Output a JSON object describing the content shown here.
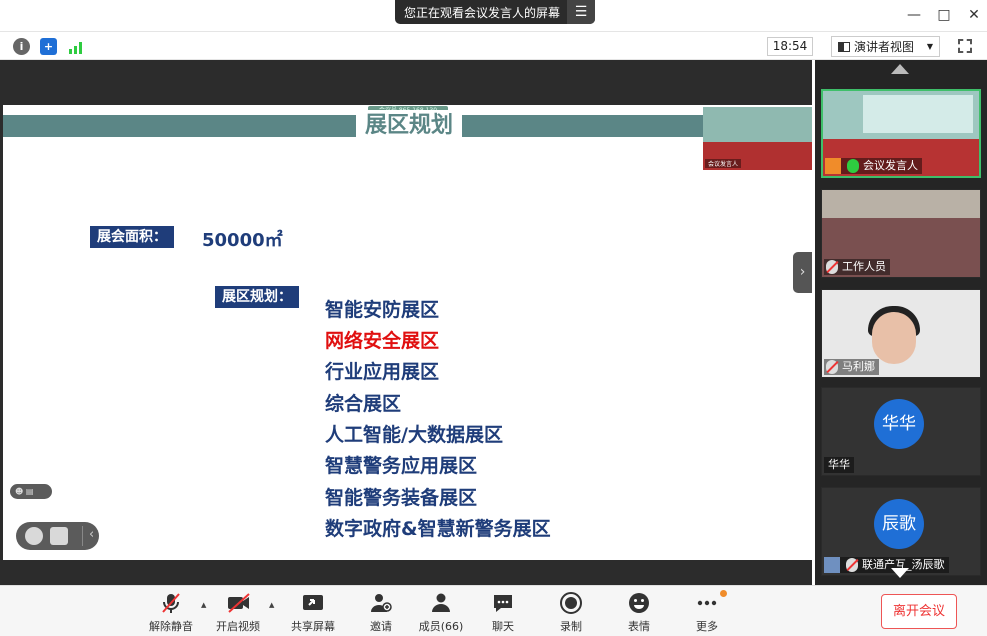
{
  "banner": {
    "text": "您正在观看会议发言人的屏幕",
    "menu_icon": "menu-icon"
  },
  "window": {
    "minimize": "—",
    "maximize": "□",
    "close": "✕"
  },
  "toolbar": {
    "info_icon": "i",
    "security_icon": "+",
    "clock": "18:54",
    "view_mode": "演讲者视图",
    "view_caret": "▼"
  },
  "slide": {
    "meeting_id": "会议号 865 168 130",
    "title": "展区规划",
    "area_label": "展会面积：",
    "area_value": "50000㎡",
    "zones_label": "展区规划：",
    "zones": [
      {
        "text": "智能安防展区",
        "highlight": false
      },
      {
        "text": "网络安全展区",
        "highlight": true
      },
      {
        "text": "行业应用展区",
        "highlight": false
      },
      {
        "text": "综合展区",
        "highlight": false
      },
      {
        "text": "人工智能/大数据展区",
        "highlight": false
      },
      {
        "text": "智慧警务应用展区",
        "highlight": false
      },
      {
        "text": "智能警务装备展区",
        "highlight": false
      },
      {
        "text": "数字政府&智慧新警务展区",
        "highlight": false
      }
    ],
    "pip_name": "会议发言人",
    "reaction_text": "☻ ▤",
    "chat_arrow": "‹"
  },
  "side_arrow": "›",
  "gallery": [
    {
      "name": "会议发言人",
      "mic": "on",
      "active": true,
      "avatar": ""
    },
    {
      "name": "工作人员",
      "mic": "off",
      "active": false,
      "avatar": ""
    },
    {
      "name": "马利娜",
      "mic": "off",
      "active": false,
      "avatar": ""
    },
    {
      "name": "华华",
      "mic": "none",
      "active": false,
      "avatar": "华华"
    },
    {
      "name": "联通产互_汤辰歌",
      "mic": "off",
      "active": false,
      "avatar": "辰歌"
    }
  ],
  "bottom": {
    "unmute": "解除静音",
    "video": "开启视频",
    "share": "共享屏幕",
    "invite": "邀请",
    "members": "成员(66)",
    "chat": "聊天",
    "record": "录制",
    "emoji": "表情",
    "more": "更多",
    "leave": "离开会议"
  },
  "colors": {
    "accent_green": "#3fbf6a",
    "slide_navy": "#1f3d7a",
    "slide_teal": "#5b8686",
    "highlight_red": "#e01010",
    "leave_red": "#e33333"
  }
}
